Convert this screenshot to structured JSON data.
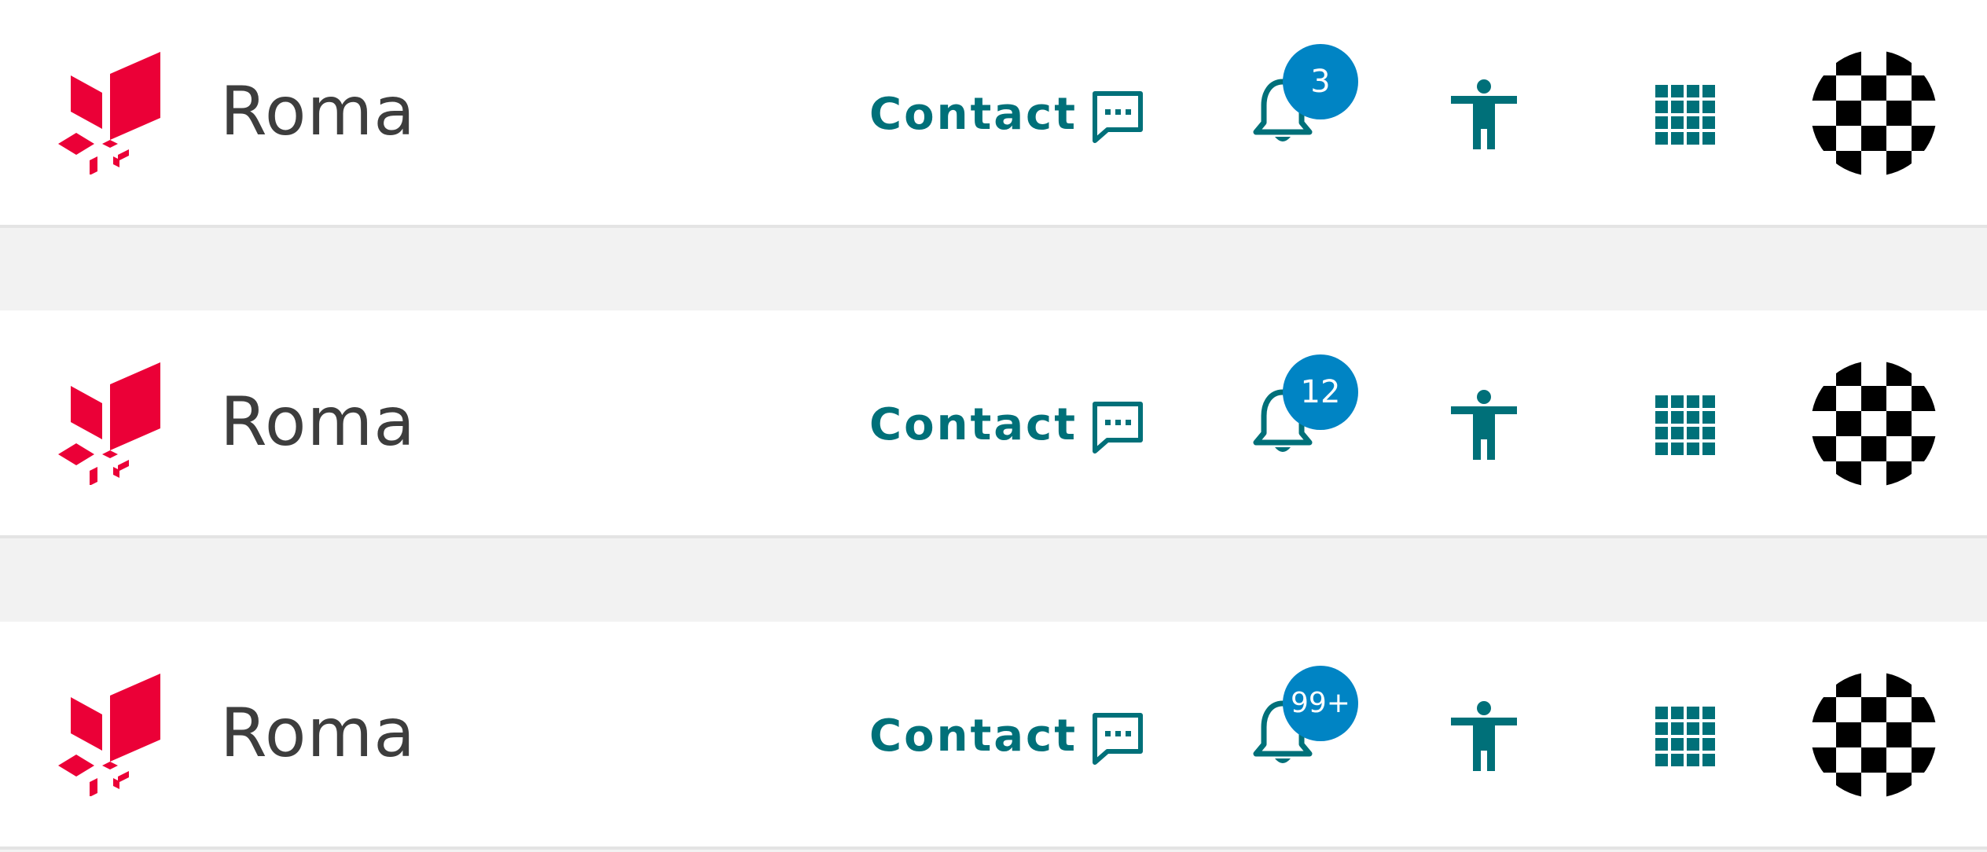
{
  "colors": {
    "brand_red": "#eb0037",
    "accent_teal": "#007079",
    "badge_blue": "#0084c4",
    "title_gray": "#3d3d3d",
    "background": "#f2f2f2"
  },
  "icons": {
    "logo": "brand-logo",
    "contact": "chat-bubble-dots-icon",
    "notifications": "bell-icon",
    "accessibility": "accessibility-person-icon",
    "apps": "grid-apps-icon",
    "avatar": "checkered-avatar"
  },
  "topbars": [
    {
      "app_title": "Roma",
      "contact_label": "Contact",
      "notification_count": "3"
    },
    {
      "app_title": "Roma",
      "contact_label": "Contact",
      "notification_count": "12"
    },
    {
      "app_title": "Roma",
      "contact_label": "Contact",
      "notification_count": "99+"
    }
  ]
}
